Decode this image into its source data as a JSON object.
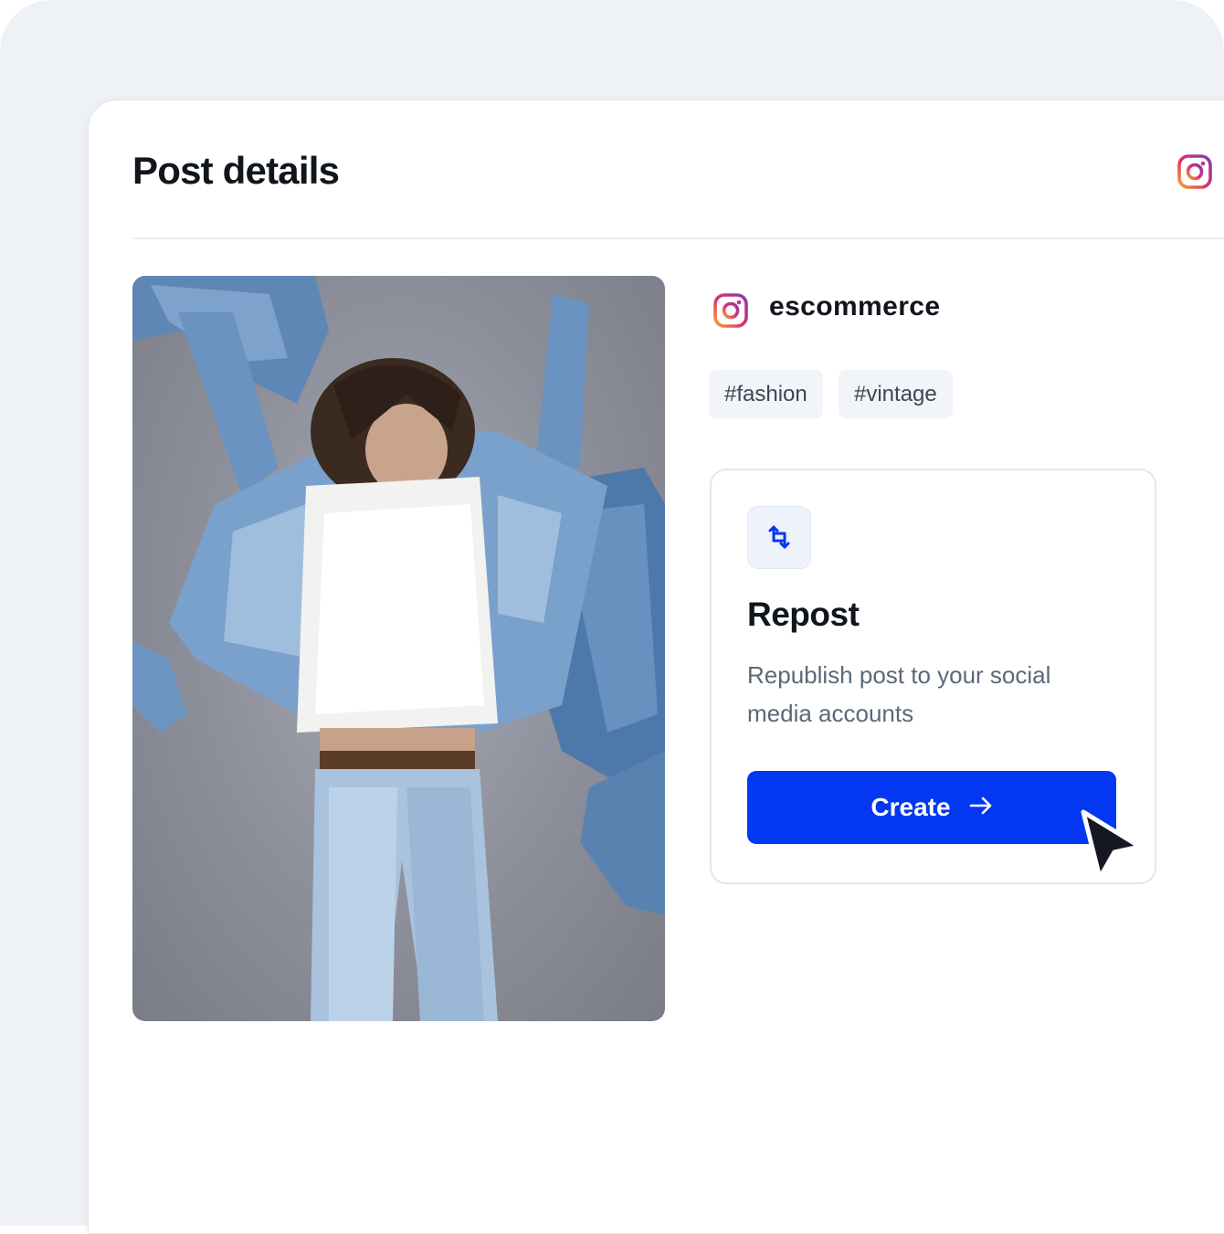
{
  "header": {
    "title": "Post details",
    "platform_icon": "instagram-icon"
  },
  "post": {
    "image_alt": "Person jumping in denim jacket and jeans",
    "account": {
      "icon": "instagram-icon",
      "name": "escommerce"
    },
    "tags": [
      "#fashion",
      "#vintage"
    ]
  },
  "repost_card": {
    "icon": "repost-icon",
    "title": "Repost",
    "description": "Republish post to your social media accounts",
    "button_label": "Create",
    "button_icon": "arrow-right-icon"
  },
  "colors": {
    "accent": "#0437f2",
    "background": "#eef1f5",
    "tag_bg": "#f1f4f8"
  }
}
